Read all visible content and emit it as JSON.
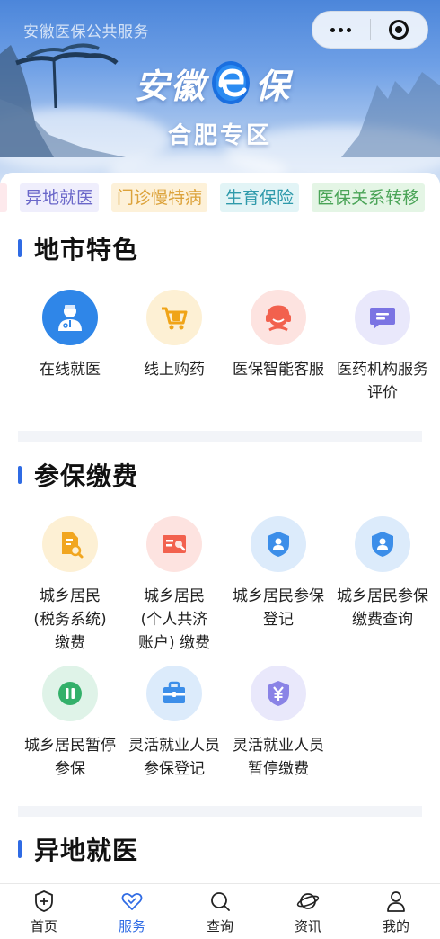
{
  "header": {
    "service_title": "安徽医保公共服务",
    "brand_left": "安徽",
    "brand_right": "保",
    "region": "合肥专区"
  },
  "tags": [
    {
      "label": "",
      "color": "pink"
    },
    {
      "label": "异地就医",
      "color": "purple"
    },
    {
      "label": "门诊慢特病",
      "color": "yellow"
    },
    {
      "label": "生育保险",
      "color": "teal"
    },
    {
      "label": "医保关系转移",
      "color": "green"
    }
  ],
  "sections": {
    "city": {
      "title": "地市特色",
      "items": [
        {
          "label": "在线就医",
          "icon": "doctor-icon"
        },
        {
          "label": "线上购药",
          "icon": "cart-icon"
        },
        {
          "label": "医保智能客服",
          "icon": "headset-icon"
        },
        {
          "label": "医药机构服务评价",
          "icon": "message-icon"
        }
      ]
    },
    "insurance": {
      "title": "参保缴费",
      "items": [
        {
          "label": "城乡居民(税务系统)缴费",
          "icon": "document-search-icon"
        },
        {
          "label": "城乡居民(个人共济账户) 缴费",
          "icon": "card-search-icon"
        },
        {
          "label": "城乡居民参保登记",
          "icon": "shield-user-icon"
        },
        {
          "label": "城乡居民参保缴费查询",
          "icon": "shield-user-icon"
        },
        {
          "label": "城乡居民暂停参保",
          "icon": "pause-icon"
        },
        {
          "label": "灵活就业人员参保登记",
          "icon": "briefcase-icon"
        },
        {
          "label": "灵活就业人员暂停缴费",
          "icon": "yuan-shield-icon"
        }
      ]
    },
    "remote": {
      "title": "异地就医"
    }
  },
  "tabbar": [
    {
      "label": "首页",
      "icon": "home-shield-icon",
      "active": false
    },
    {
      "label": "服务",
      "icon": "heart-icon",
      "active": true
    },
    {
      "label": "查询",
      "icon": "search-icon",
      "active": false
    },
    {
      "label": "资讯",
      "icon": "planet-icon",
      "active": false
    },
    {
      "label": "我的",
      "icon": "user-icon",
      "active": false
    }
  ],
  "colors": {
    "accent": "#2f6be4",
    "section_bar": "#2f6be4"
  }
}
